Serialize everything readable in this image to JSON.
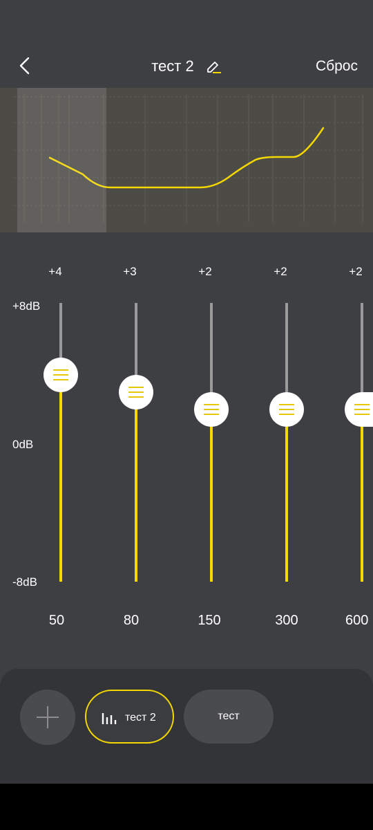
{
  "header": {
    "title": "тест 2",
    "reset_label": "Сброс"
  },
  "equalizer": {
    "db_labels": {
      "top": "+8dB",
      "mid": "0dB",
      "bottom": "-8dB"
    },
    "bands": [
      {
        "freq": "50",
        "gain_label": "+4"
      },
      {
        "freq": "80",
        "gain_label": "+3"
      },
      {
        "freq": "150",
        "gain_label": "+2"
      },
      {
        "freq": "300",
        "gain_label": "+2"
      },
      {
        "freq": "600",
        "gain_label": "+2"
      }
    ]
  },
  "presets": [
    {
      "label": "тест 2",
      "active": true
    },
    {
      "label": "тест",
      "active": false
    }
  ],
  "colors": {
    "accent": "#f4d800",
    "background": "#3e3f42",
    "panel": "#333438"
  }
}
